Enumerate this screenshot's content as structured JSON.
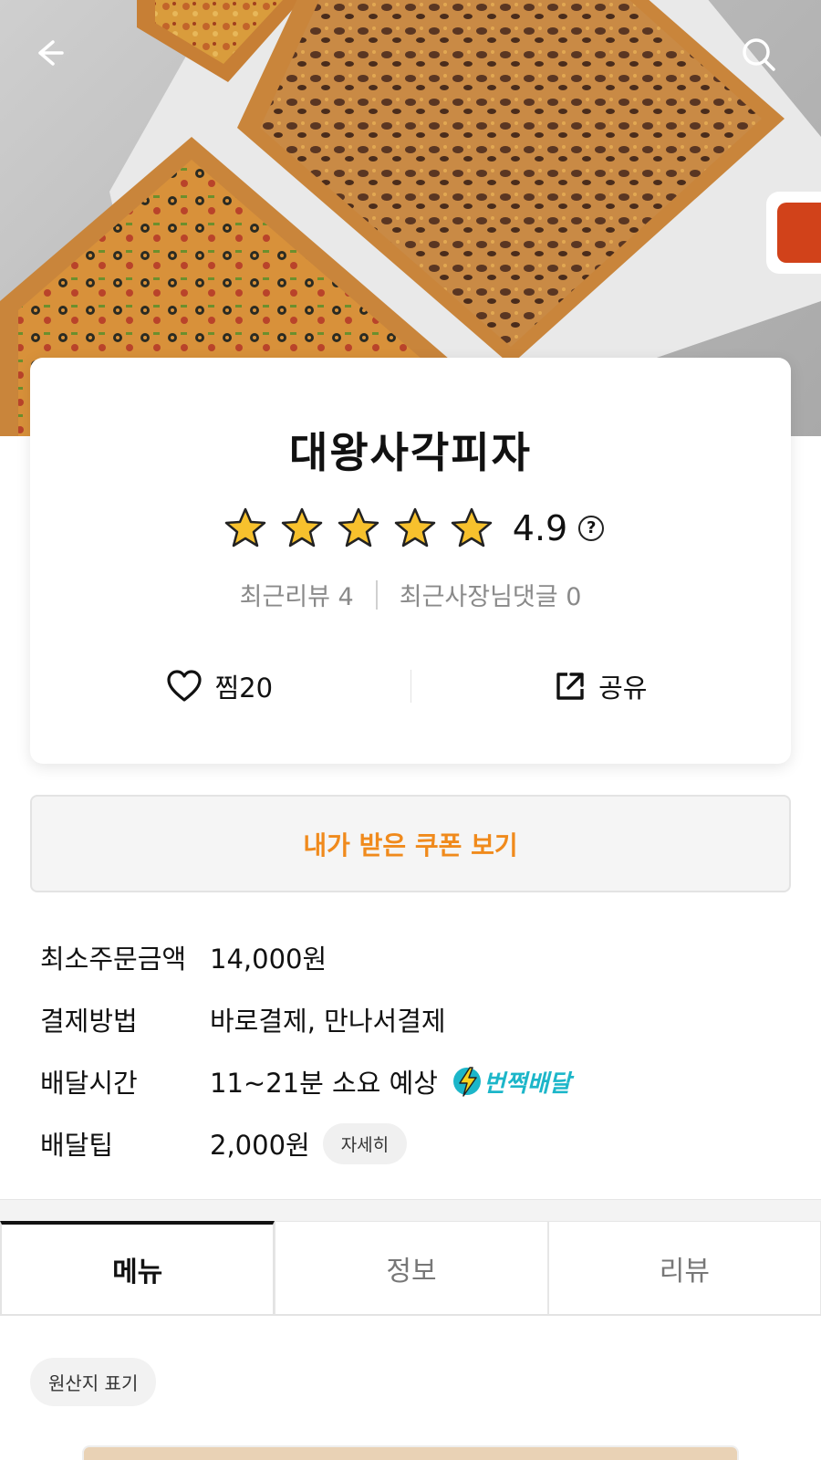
{
  "store": {
    "name": "대왕사각피자",
    "rating": "4.9",
    "help_symbol": "?",
    "star_count": 5,
    "recent_reviews": "최근리뷰 4",
    "owner_replies": "최근사장님댓글 0"
  },
  "actions": {
    "like_label": "찜20",
    "share_label": "공유"
  },
  "coupon": {
    "label": "내가 받은 쿠폰 보기"
  },
  "info": {
    "rows": [
      {
        "label": "최소주문금액",
        "value": "14,000원"
      },
      {
        "label": "결제방법",
        "value": "바로결제, 만나서결제"
      },
      {
        "label": "배달시간",
        "value": "11~21분 소요 예상",
        "badge": "번쩍배달"
      },
      {
        "label": "배달팁",
        "value": "2,000원",
        "chip": "자세히"
      }
    ]
  },
  "tabs": [
    {
      "label": "메뉴",
      "active": true
    },
    {
      "label": "정보",
      "active": false
    },
    {
      "label": "리뷰",
      "active": false
    }
  ],
  "origin_label": "원산지 표기",
  "colors": {
    "accent_orange": "#f08a1c",
    "flash_teal": "#1cb6c9",
    "star_gold": "#f7c12d"
  },
  "icons": [
    "back-arrow-icon",
    "search-icon",
    "star-icon",
    "help-icon",
    "heart-icon",
    "share-icon",
    "lightning-icon"
  ]
}
